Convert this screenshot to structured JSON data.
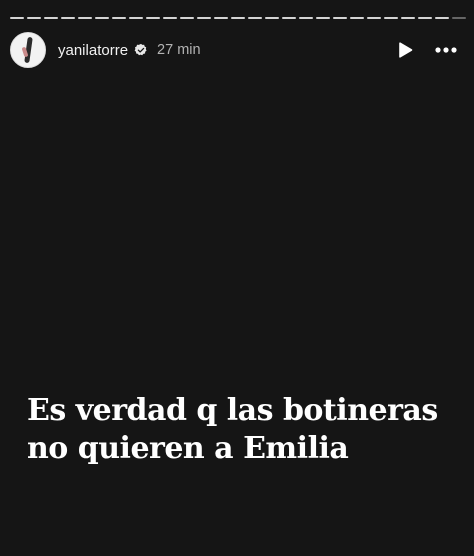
{
  "story": {
    "progress_segments": [
      {
        "state": "viewed"
      },
      {
        "state": "viewed"
      },
      {
        "state": "viewed"
      },
      {
        "state": "viewed"
      },
      {
        "state": "viewed"
      },
      {
        "state": "viewed"
      },
      {
        "state": "viewed"
      },
      {
        "state": "viewed"
      },
      {
        "state": "viewed"
      },
      {
        "state": "viewed"
      },
      {
        "state": "viewed"
      },
      {
        "state": "viewed"
      },
      {
        "state": "viewed"
      },
      {
        "state": "viewed"
      },
      {
        "state": "viewed"
      },
      {
        "state": "viewed"
      },
      {
        "state": "viewed"
      },
      {
        "state": "viewed"
      },
      {
        "state": "viewed"
      },
      {
        "state": "viewed"
      },
      {
        "state": "viewed"
      },
      {
        "state": "viewed"
      },
      {
        "state": "viewed"
      },
      {
        "state": "viewed"
      },
      {
        "state": "viewed"
      },
      {
        "state": "current"
      },
      {
        "state": "pending"
      }
    ],
    "username": "yanilatorre",
    "verified": true,
    "time": "27 min",
    "icons": {
      "avatar": "profile-avatar",
      "verified": "verified-badge-icon",
      "play": "play-icon",
      "more": "more-options-icon"
    },
    "caption": "Es verdad q las botineras no quieren a Emilia",
    "colors": {
      "background": "#151515",
      "text": "#ffffff",
      "muted": "#b3b3b3"
    }
  }
}
